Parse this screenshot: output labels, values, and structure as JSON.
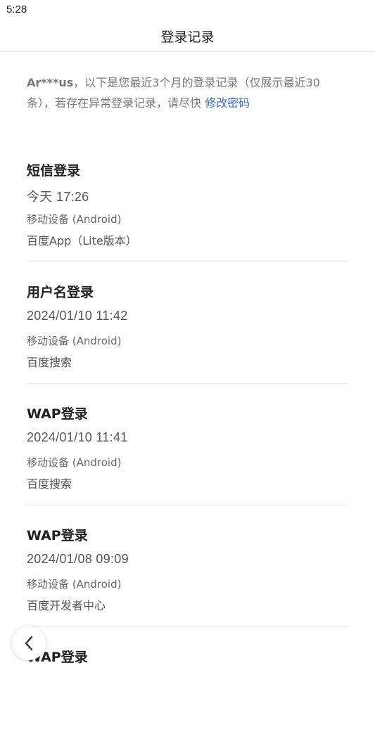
{
  "status_bar": {
    "time": "5:28"
  },
  "header": {
    "title": "登录记录"
  },
  "notice": {
    "user": "Ar***us",
    "text": "，以下是您最近3个月的登录记录（仅展示最近30条），若存在异常登录记录，请尽快",
    "link": "修改密码"
  },
  "records": [
    {
      "type": "短信登录",
      "time": "今天  17:26",
      "device": "移动设备 (Android)",
      "app": "百度App（Lite版本）"
    },
    {
      "type": "用户名登录",
      "time": "2024/01/10  11:42",
      "device": "移动设备 (Android)",
      "app": "百度搜索"
    },
    {
      "type": "WAP登录",
      "time": "2024/01/10  11:41",
      "device": "移动设备 (Android)",
      "app": "百度搜索"
    },
    {
      "type": "WAP登录",
      "time": "2024/01/08  09:09",
      "device": "移动设备 (Android)",
      "app": "百度开发者中心"
    },
    {
      "type": "WAP登录",
      "time": "",
      "device": "",
      "app": ""
    }
  ],
  "back_button": {
    "icon": "chevron-left-icon"
  }
}
